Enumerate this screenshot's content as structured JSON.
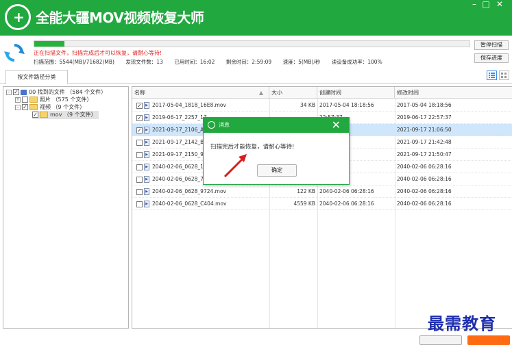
{
  "app": {
    "title": "全能大疆MOV视频恢复大师",
    "window_controls": [
      "–",
      "□",
      "✕"
    ]
  },
  "scan": {
    "progress_fraction": 0.07,
    "warning": "正在扫描文件，扫描完成后才可以恢复，请耐心等待!",
    "range": "扫描范围：5544(MB)/71682(MB)",
    "found": "发现文件数：13",
    "elapsed": "已用时间：16:02",
    "remaining": "剩余时间：2:59:09",
    "speed": "速度：5(MB)/秒",
    "read_success": "读设备成功率：100%",
    "pause_button": "暂停扫描",
    "save_button": "保存进度"
  },
  "tabs": [
    {
      "label": "按文件路径分类"
    }
  ],
  "tree": [
    {
      "label": "00 找到的文件 （584 个文件）",
      "checked": true,
      "expander": "–"
    },
    {
      "label": "照片 （575 个文件）",
      "checked": false,
      "expander": "+"
    },
    {
      "label": "视频 （9 个文件）",
      "checked": true,
      "expander": "–"
    },
    {
      "label": "mov （9 个文件）",
      "checked": true,
      "expander": ""
    }
  ],
  "list": {
    "columns": [
      "名称",
      "大小",
      "创建时间",
      "修改时间"
    ],
    "rows": [
      {
        "name": "2017-05-04_1818_16E8.mov",
        "size": "34 KB",
        "created": "2017-05-04  18:18:56",
        "modified": "2017-05-04  18:18:56",
        "checked": true,
        "selected": false
      },
      {
        "name": "2019-06-17_2257_17",
        "size": "",
        "created": "22:57:37",
        "modified": "2019-06-17  22:57:37",
        "checked": true,
        "selected": false
      },
      {
        "name": "2021-09-17_2106_A",
        "size": "",
        "created": "21:06:50",
        "modified": "2021-09-17  21:06:50",
        "checked": true,
        "selected": true
      },
      {
        "name": "2021-09-17_2142_B",
        "size": "",
        "created": "21:42:48",
        "modified": "2021-09-17  21:42:48",
        "checked": false,
        "selected": false
      },
      {
        "name": "2021-09-17_2150_9",
        "size": "",
        "created": "21:50:47",
        "modified": "2021-09-17  21:50:47",
        "checked": false,
        "selected": false
      },
      {
        "name": "2040-02-06_0628_1",
        "size": "",
        "created": "06:28:16",
        "modified": "2040-02-06  06:28:16",
        "checked": false,
        "selected": false
      },
      {
        "name": "2040-02-06_0628_7",
        "size": "",
        "created": "06:28:16",
        "modified": "2040-02-06  06:28:16",
        "checked": false,
        "selected": false
      },
      {
        "name": "2040-02-06_0628_9724.mov",
        "size": "122 KB",
        "created": "2040-02-06  06:28:16",
        "modified": "2040-02-06  06:28:16",
        "checked": false,
        "selected": false
      },
      {
        "name": "2040-02-06_0628_C404.mov",
        "size": "4559 KB",
        "created": "2040-02-06  06:28:16",
        "modified": "2040-02-06  06:28:16",
        "checked": false,
        "selected": false
      }
    ]
  },
  "dialog": {
    "title": "消息",
    "message": "扫描完后才能恢复，请耐心等待!",
    "ok": "确定",
    "close": "✕"
  },
  "watermark": "最需教育",
  "colors": {
    "accent": "#21a83f",
    "warning": "#e02020",
    "orange": "#ff6a13"
  }
}
